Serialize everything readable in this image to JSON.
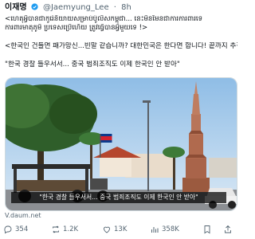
{
  "tweet": {
    "author_name": "이재명",
    "handle": "@Jaemyung_Lee",
    "separator": "·",
    "time": "8h",
    "lines": [
      "<ហេតុអ្វីបានជាកូរ៉េនិយាយសម្រាប់ប៉ូលីសកម្ពុជា... នេះមិនមែនជាការការពារទេ",
      "ការពារមាតុភូមិ ប្រទេសប្រើហើយ ត្រូវធ្វើបានអ្វីមួយទេ !>",
      "<한국인 건들면 패가망신...빈말 같습니까? 대한민국은 한다면 합니다! 끝까지 추적합니다>",
      "\"한국 경찰 들우서서... 중국 범죄조직도 이제 한국인 안 받아\""
    ]
  },
  "media": {
    "caption": "\"한국 경찰 들우서서... 중국 범죄조직도 이제 한국인 안 받아\"",
    "source": "V.daum.net"
  },
  "actions": {
    "replies": "354",
    "reposts": "1.2K",
    "likes": "13K",
    "views": "358K"
  },
  "colors": {
    "muted": "#536471",
    "verified": "#1d9bf0",
    "text": "#0f1419"
  }
}
